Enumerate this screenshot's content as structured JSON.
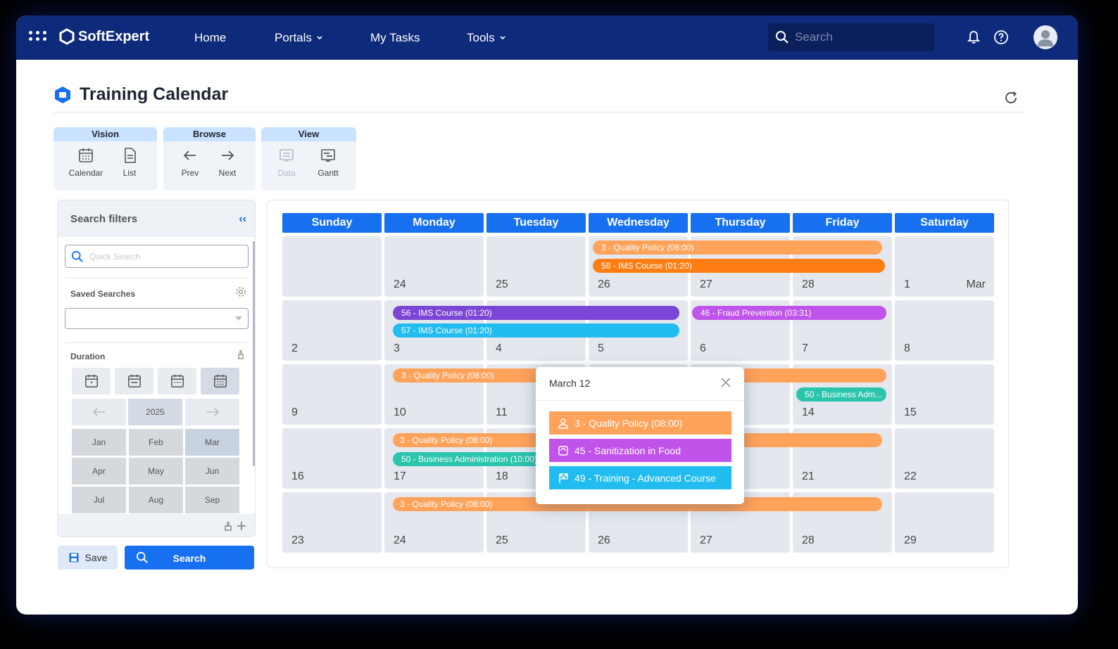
{
  "topbar": {
    "brand": "SoftExpert",
    "nav": [
      "Home",
      "Portals",
      "My Tasks",
      "Tools"
    ],
    "search_placeholder": "Search"
  },
  "page": {
    "title": "Training Calendar"
  },
  "toolbar": {
    "groups": [
      {
        "label": "Vision",
        "buttons": [
          "Calendar",
          "List"
        ]
      },
      {
        "label": "Browse",
        "buttons": [
          "Prev",
          "Next"
        ]
      },
      {
        "label": "View",
        "buttons": [
          "Data",
          "Gantt"
        ]
      }
    ]
  },
  "filters": {
    "title": "Search filters",
    "quick_search_placeholder": "Quick Search",
    "saved_searches_label": "Saved Searches",
    "duration_label": "Duration",
    "year": "2025",
    "months": [
      "Jan",
      "Feb",
      "Mar",
      "Apr",
      "May",
      "Jun",
      "Jul",
      "Aug",
      "Sep"
    ],
    "selected_month": "Mar"
  },
  "actions": {
    "save_label": "Save",
    "search_label": "Search"
  },
  "calendar": {
    "days": [
      "Sunday",
      "Monday",
      "Tuesday",
      "Wednesday",
      "Thursday",
      "Friday",
      "Saturday"
    ],
    "weeks": [
      [
        "",
        "24",
        "25",
        "26",
        "27",
        "28",
        "1"
      ],
      [
        "2",
        "3",
        "4",
        "5",
        "6",
        "7",
        "8"
      ],
      [
        "9",
        "10",
        "11",
        "",
        "",
        "14",
        "15"
      ],
      [
        "16",
        "17",
        "18",
        "",
        "",
        "21",
        "22"
      ],
      [
        "23",
        "24",
        "25",
        "26",
        "27",
        "28",
        "29"
      ]
    ],
    "month_marker": "Mar",
    "events": {
      "e1": "3 - Quality Policy (08:00)",
      "e2": "58 - IMS Course (01:20)",
      "e3": "56 - IMS Course (01:20)",
      "e4": "57 - IMS Course (01:20)",
      "e5": "46 - Fraud Prevention (03:31)",
      "e6": "3 - Quality Policy (08:00)",
      "e7": "50 - Business Adm...",
      "e8": "3 - Quality Policy (08:00)",
      "e9": "50 - Business Administration (10:00)",
      "e10": "3 - Quality Policy (08:00)"
    }
  },
  "popover": {
    "title": "March 12",
    "items": [
      "3 - Quality Policy (08:00)",
      "45 - Sanitization in Food",
      "49 - Training - Advanced Course"
    ]
  },
  "colors": {
    "topbar": "#0e2a7a",
    "accent": "#1670f0",
    "event_orange": "#ffa25a",
    "event_orange_dark": "#ff7e14",
    "event_purple": "#7b45d6",
    "event_cyan": "#22bdf0",
    "event_magenta": "#c053e9",
    "event_teal": "#2bc4ad"
  }
}
